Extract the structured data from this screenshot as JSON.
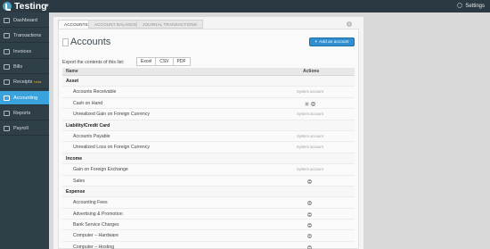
{
  "app": {
    "title": "Testing",
    "settings_label": "Settings"
  },
  "sidebar": {
    "items": [
      {
        "label": "Dashboard",
        "icon": "dashboard-icon"
      },
      {
        "label": "Transactions",
        "icon": "transactions-icon"
      },
      {
        "label": "Invoices",
        "icon": "invoices-icon"
      },
      {
        "label": "Bills",
        "icon": "bills-icon"
      },
      {
        "label": "Receipts",
        "badge": "beta",
        "icon": "receipts-icon"
      },
      {
        "label": "Accounting",
        "icon": "accounting-icon",
        "active": true
      },
      {
        "label": "Reports",
        "icon": "reports-icon"
      },
      {
        "label": "Payroll",
        "icon": "payroll-icon"
      }
    ]
  },
  "tabs": [
    "ACCOUNTS",
    "ACCOUNT BALANCES",
    "JOURNAL TRANSACTIONS"
  ],
  "help_label": "i",
  "page": {
    "title": "Accounts",
    "add_button": "Add an account",
    "export_label": "Export the contents of this list:",
    "export_buttons": [
      "Excel",
      "CSV",
      "PDF"
    ]
  },
  "table": {
    "headers": {
      "name": "Name",
      "actions": "Actions"
    },
    "system_account_label": "System account",
    "rows": [
      {
        "type": "group",
        "name": "Asset"
      },
      {
        "type": "item",
        "name": "Accounts Receivable",
        "action": "system"
      },
      {
        "type": "item",
        "name": "Cash on Hand",
        "action": "edit-remove"
      },
      {
        "type": "item",
        "name": "Unrealized Gain on Foreign Currency",
        "action": "system"
      },
      {
        "type": "group",
        "name": "Liability/Credit Card"
      },
      {
        "type": "item",
        "name": "Accounts Payable",
        "action": "system"
      },
      {
        "type": "item",
        "name": "Unrealized Loss on Foreign Currency",
        "action": "system"
      },
      {
        "type": "group",
        "name": "Income"
      },
      {
        "type": "item",
        "name": "Gain on Foreign Exchange",
        "action": "system"
      },
      {
        "type": "item",
        "name": "Sales",
        "action": "remove"
      },
      {
        "type": "group",
        "name": "Expense"
      },
      {
        "type": "item",
        "name": "Accounting Fees",
        "action": "remove"
      },
      {
        "type": "item",
        "name": "Advertising & Promotion",
        "action": "remove"
      },
      {
        "type": "item",
        "name": "Bank Service Charges",
        "action": "remove"
      },
      {
        "type": "item",
        "name": "Computer – Hardware",
        "action": "remove"
      },
      {
        "type": "item",
        "name": "Computer – Hosting",
        "action": "remove"
      }
    ]
  },
  "colors": {
    "topbar": "#2b3a42",
    "sidebar": "#2f3f47",
    "accent": "#3aa3dd",
    "button": "#2f8fd0"
  }
}
